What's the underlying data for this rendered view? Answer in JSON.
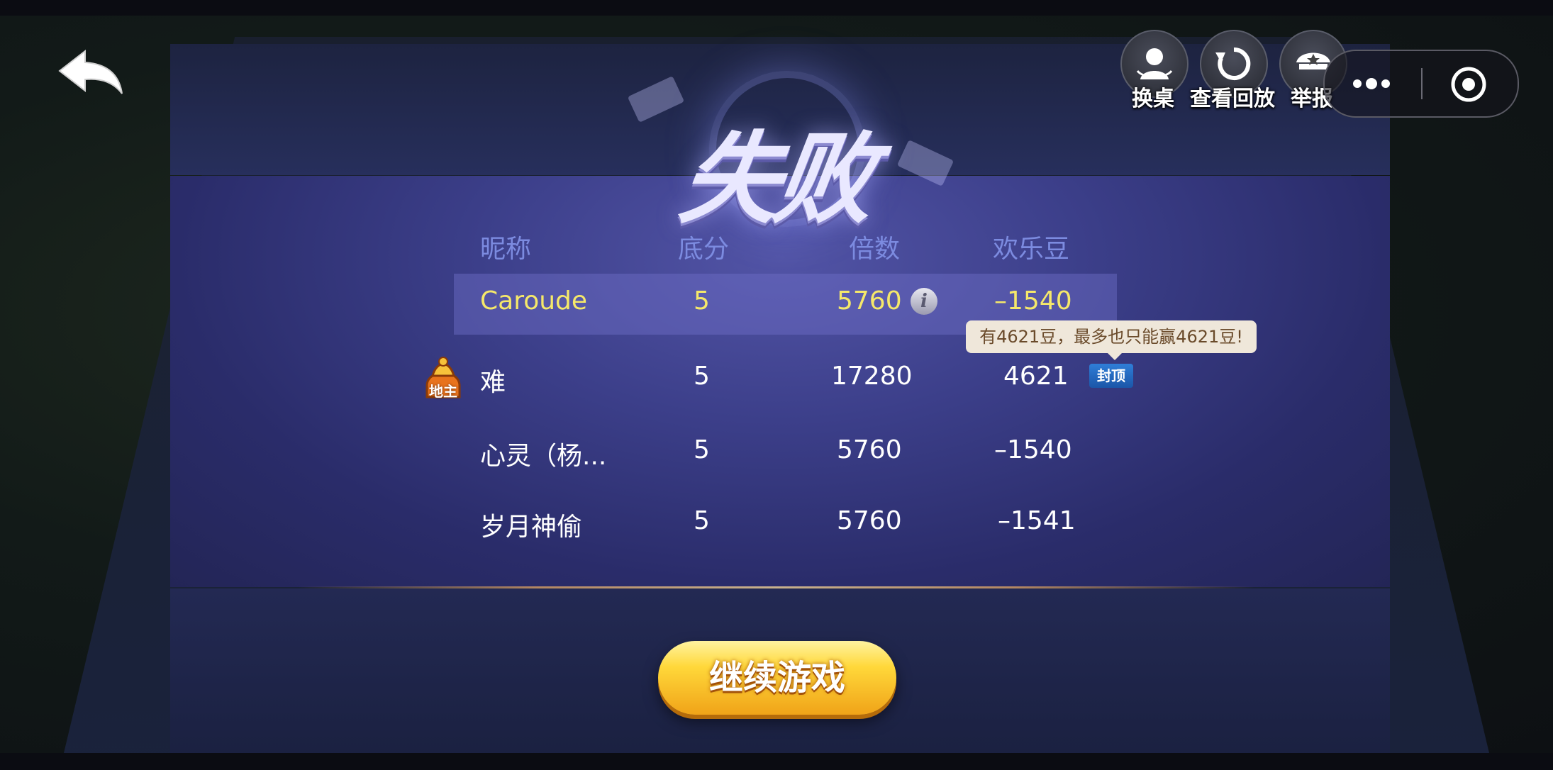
{
  "result": {
    "title": "失败"
  },
  "top_bar": {
    "change_table": "换桌",
    "replay": "查看回放",
    "report": "举报"
  },
  "columns": {
    "nickname": "昵称",
    "base_score": "底分",
    "multiplier": "倍数",
    "beans": "欢乐豆"
  },
  "rows": [
    {
      "name": "Caroude",
      "base": "5",
      "mult": "5760",
      "beans": "–1540"
    },
    {
      "name": "难",
      "base": "5",
      "mult": "17280",
      "beans": "4621"
    },
    {
      "name": "心灵（杨...",
      "base": "5",
      "mult": "5760",
      "beans": "–1540"
    },
    {
      "name": "岁月神偷",
      "base": "5",
      "mult": "5760",
      "beans": "–1541"
    }
  ],
  "landlord_badge": "地主",
  "tooltip": "有4621豆，最多也只能赢4621豆!",
  "cap_badge": "封顶",
  "continue_button": "继续游戏",
  "colors": {
    "self_highlight": "#f5e86a",
    "header": "#7c8be0",
    "button_gold": "#ffd83a"
  }
}
